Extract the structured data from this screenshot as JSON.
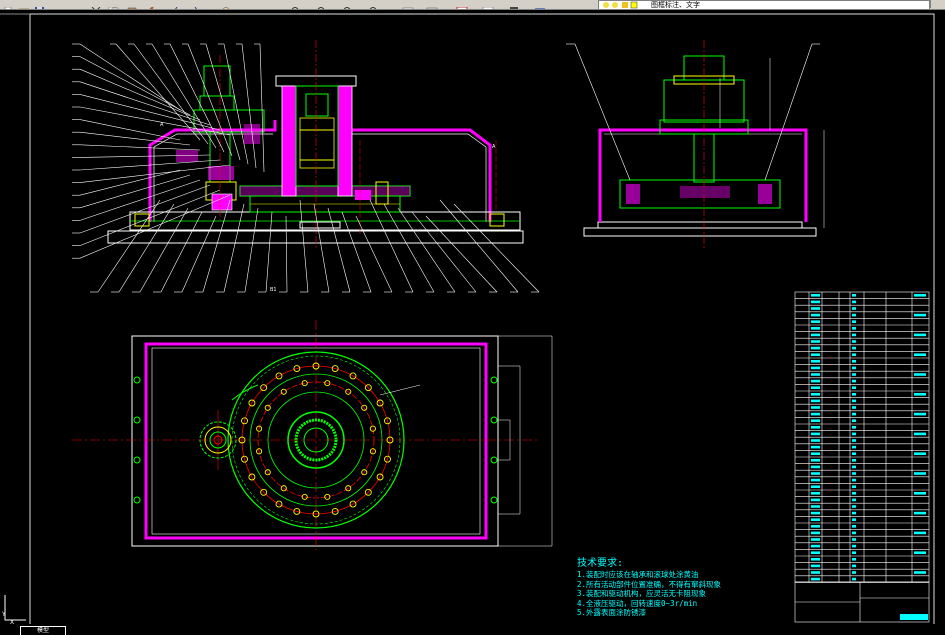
{
  "toolbar": {
    "layer_name": "图框标注、文字",
    "buttons": [
      "new",
      "open",
      "save",
      "print",
      "preview",
      "cut",
      "copy",
      "paste",
      "match",
      "undo",
      "redo",
      "pan",
      "zoom-realtime",
      "zoom-window",
      "zoom-previous",
      "properties",
      "design-center",
      "tool-palettes",
      "calculator"
    ]
  },
  "tech_requirements": {
    "title": "技术要求:",
    "items": [
      "1.装配时应该在轴承和滚球处涂黄油",
      "2.所有活动部件位置准确，不得有窜斜现象",
      "3.装配和驱动机构，应灵活无卡阻现象",
      "4.全液压驱动，回转速度0~3r/min",
      "5.外露表面涂防锈漆"
    ]
  },
  "layout_tab": "模型",
  "colors": {
    "background": "#000000",
    "outline": "#ffffff",
    "parts": "#00ff00",
    "hatch": "#ff00ff",
    "leaders": "#ffffff",
    "centerline": "#ff0000",
    "bolts": "#ffff00",
    "text": "#00ffff"
  }
}
